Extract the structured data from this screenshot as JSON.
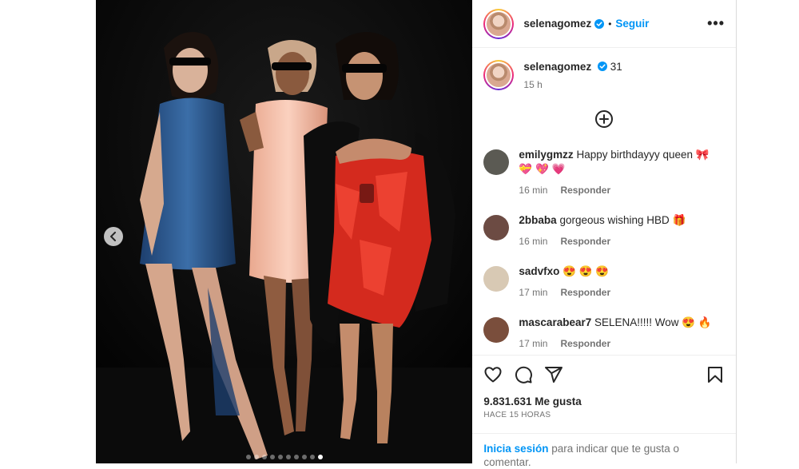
{
  "post": {
    "username": "selenagomez",
    "follow_label": "Seguir",
    "separator": "•",
    "more_label": "•••",
    "caption_text": "31",
    "caption_time": "15 h"
  },
  "comments": [
    {
      "user": "emilygmzz",
      "text": "Happy birthdayyy queen 🎀 💝 💖 💗",
      "time": "16 min",
      "reply": "Responder",
      "avatar_color": "#5b5a53"
    },
    {
      "user": "2bbaba",
      "text": "gorgeous wishing HBD 🎁",
      "time": "16 min",
      "reply": "Responder",
      "avatar_color": "#6c4b43"
    },
    {
      "user": "sadvfxo",
      "text": "😍 😍 😍",
      "time": "17 min",
      "reply": "Responder",
      "avatar_color": "#d8c9b4"
    },
    {
      "user": "mascarabear7",
      "text": "SELENA!!!!! Wow 😍 🔥",
      "time": "17 min",
      "reply": "Responder",
      "avatar_color": "#7a4e3c"
    }
  ],
  "actions": {
    "likes": "9.831.631 Me gusta",
    "time_ago": "HACE 15 HORAS",
    "login_link": "Inicia sesión",
    "login_text": " para indicar que te gusta o comentar."
  },
  "carousel": {
    "total_dots": 10,
    "active_index": 9
  },
  "colors": {
    "link_blue": "#0095f6",
    "text_dark": "#262626",
    "text_muted": "#737373"
  },
  "icons": [
    "chevron-left-icon",
    "verified-badge-icon",
    "more-options-icon",
    "add-circle-icon",
    "heart-icon",
    "comment-icon",
    "share-icon",
    "bookmark-icon"
  ]
}
